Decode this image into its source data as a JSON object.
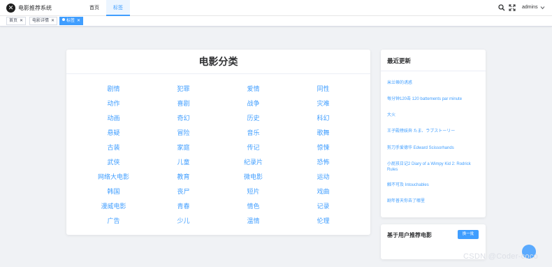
{
  "navbar": {
    "logo_text": "✕",
    "app_title": "电影推荐系统",
    "menu": [
      {
        "label": "首页"
      },
      {
        "label": "标签"
      }
    ],
    "user_name": "admins"
  },
  "tags": [
    {
      "label": "首页"
    },
    {
      "label": "电影详情"
    },
    {
      "label": "标签"
    }
  ],
  "main": {
    "title": "电影分类",
    "genres": [
      "剧情",
      "犯罪",
      "爱情",
      "同性",
      "动作",
      "喜剧",
      "战争",
      "灾难",
      "动画",
      "奇幻",
      "历史",
      "科幻",
      "悬疑",
      "冒险",
      "音乐",
      "歌舞",
      "古装",
      "家庭",
      "传记",
      "惊悚",
      "武侠",
      "儿童",
      "纪录片",
      "恐怖",
      "网络大电影",
      "教育",
      "微电影",
      "运动",
      "韩国",
      "丧尸",
      "短片",
      "戏曲",
      "漫威电影",
      "青春",
      "情色",
      "记录",
      "广告",
      "少儿",
      "温情",
      "伦理"
    ]
  },
  "recent": {
    "title": "最近更新",
    "items": [
      "米兰蒂的诱惑",
      "每分钟120击 120 battements par minute",
      "大火",
      "王子殿榜妓奔 たま、ラブストーリー",
      "剪刀手爱德华 Edward Scissorhands",
      "小屁孩日记2 Diary of a Wimpy Kid 2: Rodrick Rules",
      "触不可及 Intouchables",
      "剧年普天你去了哪里"
    ]
  },
  "recommend": {
    "title": "基于用户推荐电影",
    "button_label": "换一批"
  },
  "watermark": "CSDN @Coder-coco",
  "colors": {
    "accent": "#409eff",
    "background": "#f0f2f5"
  }
}
